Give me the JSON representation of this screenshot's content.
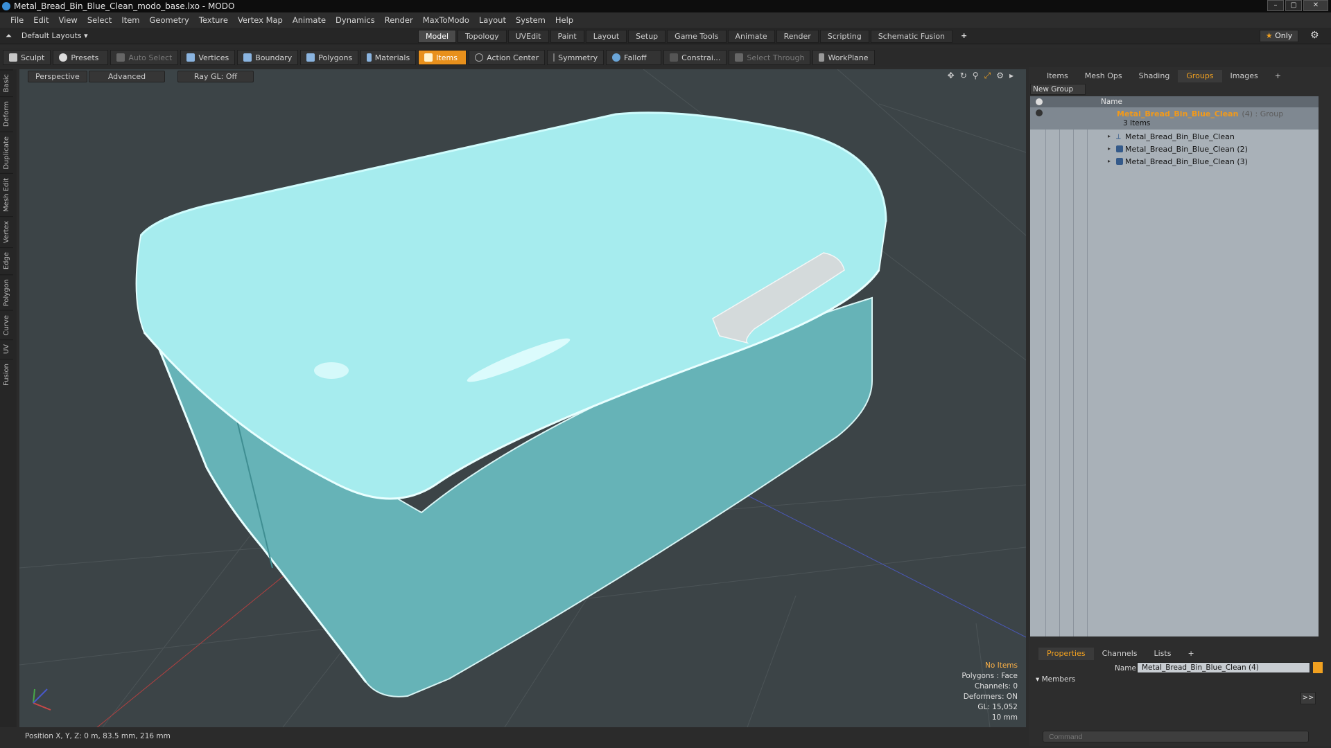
{
  "window": {
    "title": "Metal_Bread_Bin_Blue_Clean_modo_base.lxo - MODO",
    "buttons": [
      "–",
      "▢",
      "✕"
    ]
  },
  "menu": [
    "File",
    "Edit",
    "View",
    "Select",
    "Item",
    "Geometry",
    "Texture",
    "Vertex Map",
    "Animate",
    "Dynamics",
    "Render",
    "MaxToModo",
    "Layout",
    "System",
    "Help"
  ],
  "layout_selector": {
    "label": "Default Layouts ▾"
  },
  "mode_tabs": [
    {
      "label": "Model",
      "active": true
    },
    {
      "label": "Topology"
    },
    {
      "label": "UVEdit"
    },
    {
      "label": "Paint"
    },
    {
      "label": "Layout"
    },
    {
      "label": "Setup"
    },
    {
      "label": "Game Tools"
    },
    {
      "label": "Animate"
    },
    {
      "label": "Render"
    },
    {
      "label": "Scripting"
    },
    {
      "label": "Schematic Fusion"
    }
  ],
  "only_button": {
    "star": "★",
    "label": "Only"
  },
  "toolbar": [
    {
      "label": "Sculpt",
      "icon": "brush-icon"
    },
    {
      "label": "Presets",
      "icon": "presets-icon"
    },
    {
      "label": "Auto Select",
      "icon": "auto-select-icon",
      "dim": true
    },
    {
      "label": "Vertices",
      "icon": "vertices-icon"
    },
    {
      "label": "Boundary",
      "icon": "boundary-icon"
    },
    {
      "label": "Polygons",
      "icon": "polygons-icon"
    },
    {
      "label": "Materials",
      "icon": "materials-icon"
    },
    {
      "label": "Items",
      "icon": "items-icon",
      "active": true
    },
    {
      "label": "Action Center",
      "icon": "action-center-icon"
    },
    {
      "label": "Symmetry",
      "icon": "symmetry-icon"
    },
    {
      "label": "Falloff",
      "icon": "falloff-icon"
    },
    {
      "label": "Constrai...",
      "icon": "constrain-icon"
    },
    {
      "label": "Select Through",
      "icon": "select-through-icon",
      "dim": true
    },
    {
      "label": "WorkPlane",
      "icon": "workplane-icon"
    }
  ],
  "left_tabs": [
    "Basic",
    "Deform",
    "Duplicate",
    "Mesh Edit",
    "Vertex",
    "Edge",
    "Polygon",
    "Curve",
    "UV",
    "Fusion"
  ],
  "viewport": {
    "view": "Perspective",
    "shading": "Advanced",
    "raygl": "Ray GL: Off",
    "info": {
      "selection": "No Items",
      "polygons": "Polygons : Face",
      "channels": "Channels: 0",
      "deformers": "Deformers: ON",
      "gl": "GL: 15,052",
      "scale": "10 mm"
    },
    "colors": {
      "background": "#3c4447",
      "model": "#6fbcc0",
      "lid": "#a9ecee",
      "handle": "#d4dadb"
    }
  },
  "status": {
    "position": "Position X, Y, Z:  0 m, 83.5 mm, 216 mm"
  },
  "right_panel": {
    "tabs": [
      {
        "label": "Items"
      },
      {
        "label": "Mesh Ops"
      },
      {
        "label": "Shading"
      },
      {
        "label": "Groups",
        "active": true
      },
      {
        "label": "Images"
      },
      {
        "label": "+"
      }
    ],
    "new_group": "New Group",
    "column_name": "Name",
    "group": {
      "name": "Metal_Bread_Bin_Blue_Clean",
      "suffix": "(4) : Group",
      "count": "3 Items"
    },
    "items": [
      "Metal_Bread_Bin_Blue_Clean",
      "Metal_Bread_Bin_Blue_Clean (2)",
      "Metal_Bread_Bin_Blue_Clean (3)"
    ],
    "prop_tabs": [
      {
        "label": "Properties",
        "active": true
      },
      {
        "label": "Channels"
      },
      {
        "label": "Lists"
      },
      {
        "label": "+"
      }
    ],
    "name_label": "Name",
    "name_value": "Metal_Bread_Bin_Blue_Clean (4)",
    "members_label": "Members",
    "members_button": ">>",
    "command_placeholder": "Command"
  }
}
